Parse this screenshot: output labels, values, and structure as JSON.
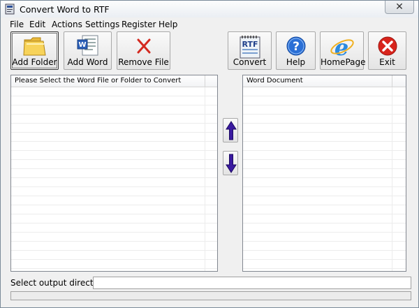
{
  "window": {
    "title": "Convert Word to RTF",
    "close_glyph": "✕"
  },
  "menu": [
    "File",
    "Edit",
    "Actions",
    "Settings",
    "Register",
    "Help"
  ],
  "toolbar": {
    "add_folder": "Add Folder",
    "add_word": "Add Word",
    "remove_file": "Remove File",
    "convert": "Convert",
    "help": "Help",
    "homepage": "HomePage",
    "exit": "Exit"
  },
  "icons": {
    "add_folder": "folder-icon",
    "add_word": "word-document-icon",
    "remove_file": "red-x-icon",
    "convert": "rtf-notepad-icon",
    "rtf_badge": "RTF",
    "help": "question-mark-icon",
    "homepage": "internet-explorer-icon",
    "exit": "exit-x-icon",
    "move_up": "arrow-up-icon",
    "move_down": "arrow-down-icon"
  },
  "left_panel": {
    "header": "Please Select the Word File or Folder to Convert",
    "rows": []
  },
  "right_panel": {
    "header": "Word Document",
    "rows": []
  },
  "output": {
    "label": "Select  output directory:",
    "value": ""
  },
  "colors": {
    "accent_blue": "#1f5fbf",
    "arrow_purple": "#3a1aa0",
    "exit_red": "#d0201c"
  }
}
